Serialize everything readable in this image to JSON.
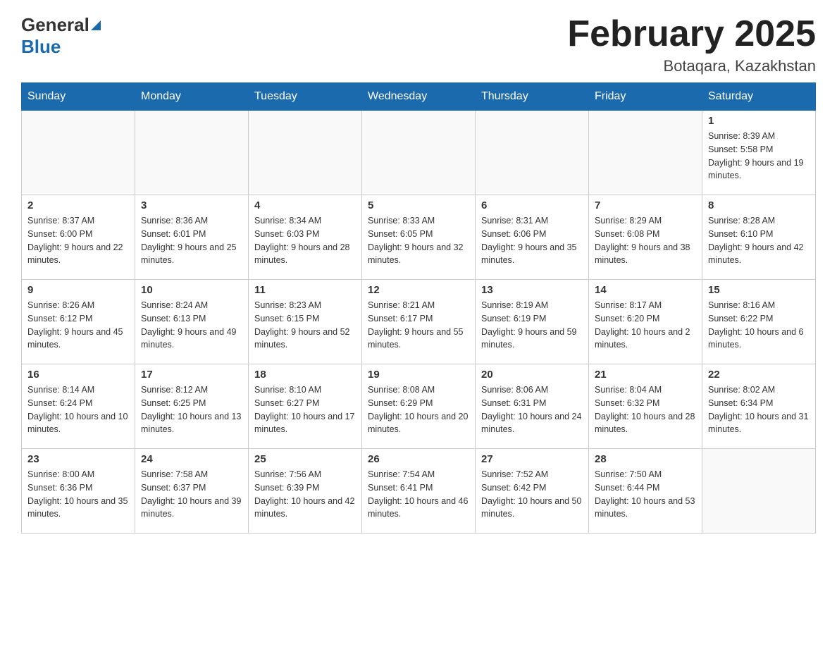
{
  "header": {
    "logo_general": "General",
    "logo_blue": "Blue",
    "month_title": "February 2025",
    "location": "Botaqara, Kazakhstan"
  },
  "weekdays": [
    "Sunday",
    "Monday",
    "Tuesday",
    "Wednesday",
    "Thursday",
    "Friday",
    "Saturday"
  ],
  "weeks": [
    [
      {
        "day": "",
        "info": ""
      },
      {
        "day": "",
        "info": ""
      },
      {
        "day": "",
        "info": ""
      },
      {
        "day": "",
        "info": ""
      },
      {
        "day": "",
        "info": ""
      },
      {
        "day": "",
        "info": ""
      },
      {
        "day": "1",
        "info": "Sunrise: 8:39 AM\nSunset: 5:58 PM\nDaylight: 9 hours and 19 minutes."
      }
    ],
    [
      {
        "day": "2",
        "info": "Sunrise: 8:37 AM\nSunset: 6:00 PM\nDaylight: 9 hours and 22 minutes."
      },
      {
        "day": "3",
        "info": "Sunrise: 8:36 AM\nSunset: 6:01 PM\nDaylight: 9 hours and 25 minutes."
      },
      {
        "day": "4",
        "info": "Sunrise: 8:34 AM\nSunset: 6:03 PM\nDaylight: 9 hours and 28 minutes."
      },
      {
        "day": "5",
        "info": "Sunrise: 8:33 AM\nSunset: 6:05 PM\nDaylight: 9 hours and 32 minutes."
      },
      {
        "day": "6",
        "info": "Sunrise: 8:31 AM\nSunset: 6:06 PM\nDaylight: 9 hours and 35 minutes."
      },
      {
        "day": "7",
        "info": "Sunrise: 8:29 AM\nSunset: 6:08 PM\nDaylight: 9 hours and 38 minutes."
      },
      {
        "day": "8",
        "info": "Sunrise: 8:28 AM\nSunset: 6:10 PM\nDaylight: 9 hours and 42 minutes."
      }
    ],
    [
      {
        "day": "9",
        "info": "Sunrise: 8:26 AM\nSunset: 6:12 PM\nDaylight: 9 hours and 45 minutes."
      },
      {
        "day": "10",
        "info": "Sunrise: 8:24 AM\nSunset: 6:13 PM\nDaylight: 9 hours and 49 minutes."
      },
      {
        "day": "11",
        "info": "Sunrise: 8:23 AM\nSunset: 6:15 PM\nDaylight: 9 hours and 52 minutes."
      },
      {
        "day": "12",
        "info": "Sunrise: 8:21 AM\nSunset: 6:17 PM\nDaylight: 9 hours and 55 minutes."
      },
      {
        "day": "13",
        "info": "Sunrise: 8:19 AM\nSunset: 6:19 PM\nDaylight: 9 hours and 59 minutes."
      },
      {
        "day": "14",
        "info": "Sunrise: 8:17 AM\nSunset: 6:20 PM\nDaylight: 10 hours and 2 minutes."
      },
      {
        "day": "15",
        "info": "Sunrise: 8:16 AM\nSunset: 6:22 PM\nDaylight: 10 hours and 6 minutes."
      }
    ],
    [
      {
        "day": "16",
        "info": "Sunrise: 8:14 AM\nSunset: 6:24 PM\nDaylight: 10 hours and 10 minutes."
      },
      {
        "day": "17",
        "info": "Sunrise: 8:12 AM\nSunset: 6:25 PM\nDaylight: 10 hours and 13 minutes."
      },
      {
        "day": "18",
        "info": "Sunrise: 8:10 AM\nSunset: 6:27 PM\nDaylight: 10 hours and 17 minutes."
      },
      {
        "day": "19",
        "info": "Sunrise: 8:08 AM\nSunset: 6:29 PM\nDaylight: 10 hours and 20 minutes."
      },
      {
        "day": "20",
        "info": "Sunrise: 8:06 AM\nSunset: 6:31 PM\nDaylight: 10 hours and 24 minutes."
      },
      {
        "day": "21",
        "info": "Sunrise: 8:04 AM\nSunset: 6:32 PM\nDaylight: 10 hours and 28 minutes."
      },
      {
        "day": "22",
        "info": "Sunrise: 8:02 AM\nSunset: 6:34 PM\nDaylight: 10 hours and 31 minutes."
      }
    ],
    [
      {
        "day": "23",
        "info": "Sunrise: 8:00 AM\nSunset: 6:36 PM\nDaylight: 10 hours and 35 minutes."
      },
      {
        "day": "24",
        "info": "Sunrise: 7:58 AM\nSunset: 6:37 PM\nDaylight: 10 hours and 39 minutes."
      },
      {
        "day": "25",
        "info": "Sunrise: 7:56 AM\nSunset: 6:39 PM\nDaylight: 10 hours and 42 minutes."
      },
      {
        "day": "26",
        "info": "Sunrise: 7:54 AM\nSunset: 6:41 PM\nDaylight: 10 hours and 46 minutes."
      },
      {
        "day": "27",
        "info": "Sunrise: 7:52 AM\nSunset: 6:42 PM\nDaylight: 10 hours and 50 minutes."
      },
      {
        "day": "28",
        "info": "Sunrise: 7:50 AM\nSunset: 6:44 PM\nDaylight: 10 hours and 53 minutes."
      },
      {
        "day": "",
        "info": ""
      }
    ]
  ]
}
